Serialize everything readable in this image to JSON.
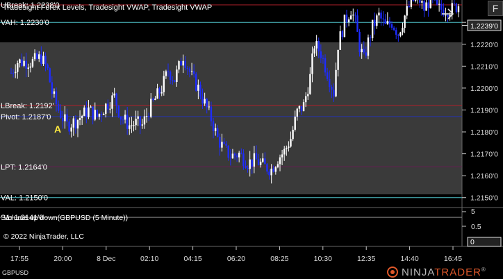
{
  "window": {
    "indicators_label": "Tradesight Forex Levels, Tradesight VWAP, Tradesight VWAP",
    "f_button": "F",
    "nav_arrow": "arrow-right-icon"
  },
  "price_axis": {
    "ticks": [
      "1.2230'0",
      "1.2220'0",
      "1.2210'0",
      "1.2200'0",
      "1.2190'0",
      "1.2180'0",
      "1.2170'0",
      "1.2160'0",
      "1.2150'0"
    ],
    "current_price": "1.2239'0",
    "ylim": [
      1.21458,
      1.22402
    ]
  },
  "levels": [
    {
      "label": "UBreak: 1.2238'0",
      "value": 1.2238,
      "color": "#b0202a"
    },
    {
      "label": "VAH: 1.2230'0",
      "value": 1.223,
      "color": "#4fc3c9"
    },
    {
      "label": "LBreak: 1.2192'",
      "value": 1.2192,
      "color": "#b0202a"
    },
    {
      "label": "Pivot: 1.2187'0",
      "value": 1.2187,
      "color": "#2233bb"
    },
    {
      "label": "LPT: 1.2164'0",
      "value": 1.2164,
      "color": "#6a1a55"
    },
    {
      "label": "VAL: 1.2150'0",
      "value": 1.215,
      "color": "#4fc3c9"
    },
    {
      "label": "S1: 1.2141'0",
      "value": 1.2141,
      "color": "#8a8a8a"
    }
  ],
  "annotation": {
    "text": "A",
    "color": "#ffea40"
  },
  "volume_panel": {
    "label": "Volume up down(GBPUSD (5 Minute))",
    "ticks": [
      "5",
      "0.5",
      "0"
    ],
    "copyright": "© 2022 NinjaTrader, LLC"
  },
  "time_axis": {
    "labels": [
      "17:55",
      "20:00",
      "8 Dec",
      "02:10",
      "04:15",
      "06:20",
      "08:25",
      "10:30",
      "12:35",
      "14:40",
      "16:45"
    ]
  },
  "instrument": "GBPUSD",
  "logo": {
    "text_a": "NINJA",
    "text_b": "TRADER",
    "mark": "®"
  },
  "chart_data": {
    "type": "bar",
    "title": "",
    "instrument": "GBPUSD",
    "timeframe": "5 Minute",
    "x_labels": [
      "17:55",
      "20:00",
      "8 Dec",
      "02:10",
      "04:15",
      "06:20",
      "08:25",
      "10:30",
      "12:35",
      "14:40",
      "16:45"
    ],
    "close_path": [
      [
        0,
        1.2207
      ],
      [
        3,
        1.2212
      ],
      [
        6,
        1.2212
      ],
      [
        10,
        1.2212
      ],
      [
        14,
        1.2214
      ],
      [
        17,
        1.2208
      ],
      [
        19,
        1.2198
      ],
      [
        22,
        1.219
      ],
      [
        26,
        1.2183
      ],
      [
        30,
        1.2185
      ],
      [
        36,
        1.219
      ],
      [
        40,
        1.2187
      ],
      [
        44,
        1.2192
      ],
      [
        48,
        1.2196
      ],
      [
        51,
        1.2187
      ],
      [
        55,
        1.2183
      ],
      [
        58,
        1.2184
      ],
      [
        61,
        1.2183
      ],
      [
        64,
        1.219
      ],
      [
        67,
        1.2195
      ],
      [
        70,
        1.22
      ],
      [
        73,
        1.2208
      ],
      [
        76,
        1.2204
      ],
      [
        80,
        1.2215
      ],
      [
        84,
        1.2205
      ],
      [
        87,
        1.22
      ],
      [
        90,
        1.2193
      ],
      [
        93,
        1.2186
      ],
      [
        96,
        1.2177
      ],
      [
        99,
        1.2172
      ],
      [
        102,
        1.2169
      ],
      [
        106,
        1.217
      ],
      [
        110,
        1.2166
      ],
      [
        114,
        1.2167
      ],
      [
        118,
        1.2164
      ],
      [
        121,
        1.2163
      ],
      [
        124,
        1.2168
      ],
      [
        127,
        1.2171
      ],
      [
        130,
        1.2177
      ],
      [
        133,
        1.2189
      ],
      [
        136,
        1.2192
      ],
      [
        139,
        1.2205
      ],
      [
        141,
        1.222
      ],
      [
        144,
        1.2216
      ],
      [
        147,
        1.2207
      ],
      [
        150,
        1.2198
      ],
      [
        152,
        1.222
      ],
      [
        155,
        1.223
      ],
      [
        158,
        1.2236
      ],
      [
        160,
        1.223
      ],
      [
        162,
        1.2219
      ],
      [
        164,
        1.2213
      ],
      [
        166,
        1.2221
      ],
      [
        168,
        1.2228
      ],
      [
        171,
        1.2233
      ],
      [
        174,
        1.2228
      ],
      [
        177,
        1.223
      ],
      [
        180,
        1.2225
      ],
      [
        183,
        1.2233
      ],
      [
        186,
        1.2239
      ],
      [
        189,
        1.2242
      ],
      [
        192,
        1.2236
      ],
      [
        195,
        1.2241
      ],
      [
        198,
        1.2236
      ],
      [
        201,
        1.2236
      ],
      [
        205,
        1.2236
      ],
      [
        208,
        1.2238
      ]
    ],
    "candle_count": 208,
    "ylim": [
      1.21458,
      1.22402
    ]
  }
}
